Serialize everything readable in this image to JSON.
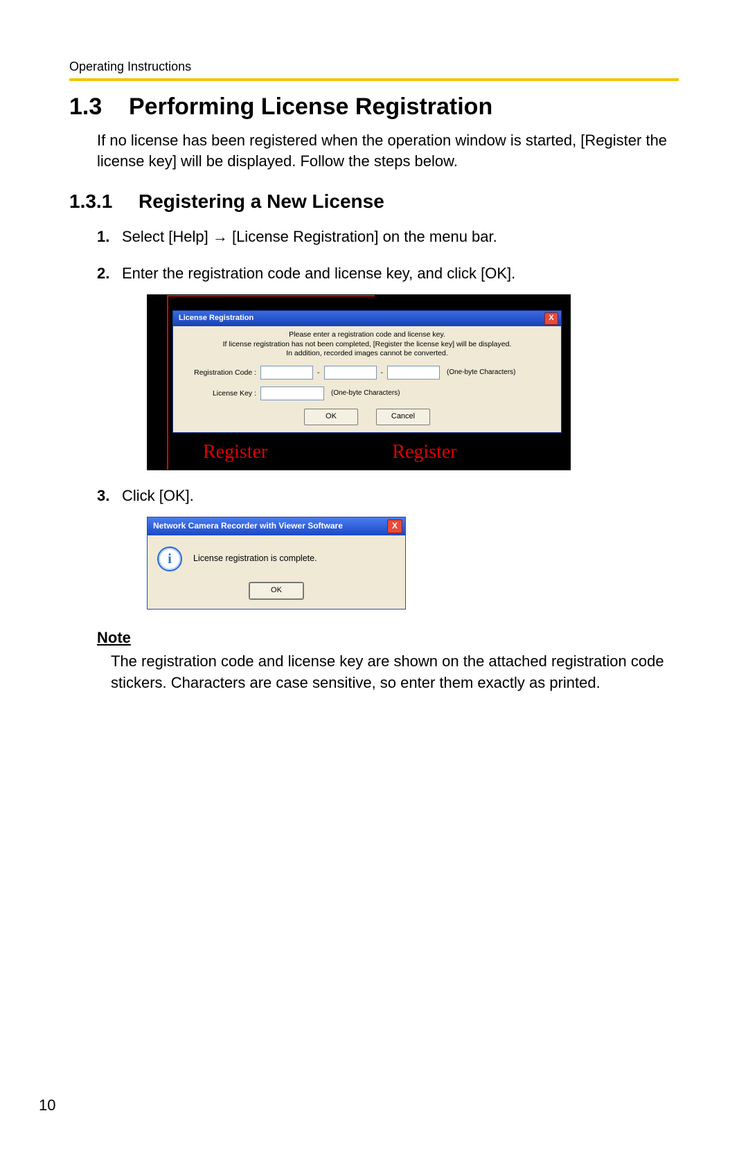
{
  "runningHead": "Operating Instructions",
  "pageNumber": "10",
  "section": {
    "num": "1.3",
    "title": "Performing License Registration"
  },
  "intro": "If no license has been registered when the operation window is started, [Register the license key] will be displayed. Follow the steps below.",
  "subsection": {
    "num": "1.3.1",
    "title": "Registering a New License"
  },
  "steps": {
    "s1": {
      "n": "1.",
      "pre": "Select [Help] ",
      "arrow": "→",
      "post": " [License Registration] on the menu bar."
    },
    "s2": {
      "n": "2.",
      "text": "Enter the registration code and license key, and click [OK]."
    },
    "s3": {
      "n": "3.",
      "text": "Click [OK]."
    }
  },
  "dialog1": {
    "title": "License Registration",
    "close": "X",
    "line1": "Please enter a registration code and license key.",
    "line2": "If license registration has not been completed, [Register the license key] will be displayed.",
    "line3": "In addition, recorded images cannot be converted.",
    "regLabel": "Registration Code :",
    "keyLabel": "License Key :",
    "sep": "-",
    "hint": "(One-byte Characters)",
    "ok": "OK",
    "cancel": "Cancel",
    "redWord": "Register"
  },
  "dialog2": {
    "title": "Network Camera Recorder with Viewer Software",
    "close": "X",
    "message": "License registration is complete.",
    "ok": "OK"
  },
  "note": {
    "head": "Note",
    "body": "The registration code and license key are shown on the attached registration code stickers. Characters are case sensitive, so enter them exactly as printed."
  }
}
